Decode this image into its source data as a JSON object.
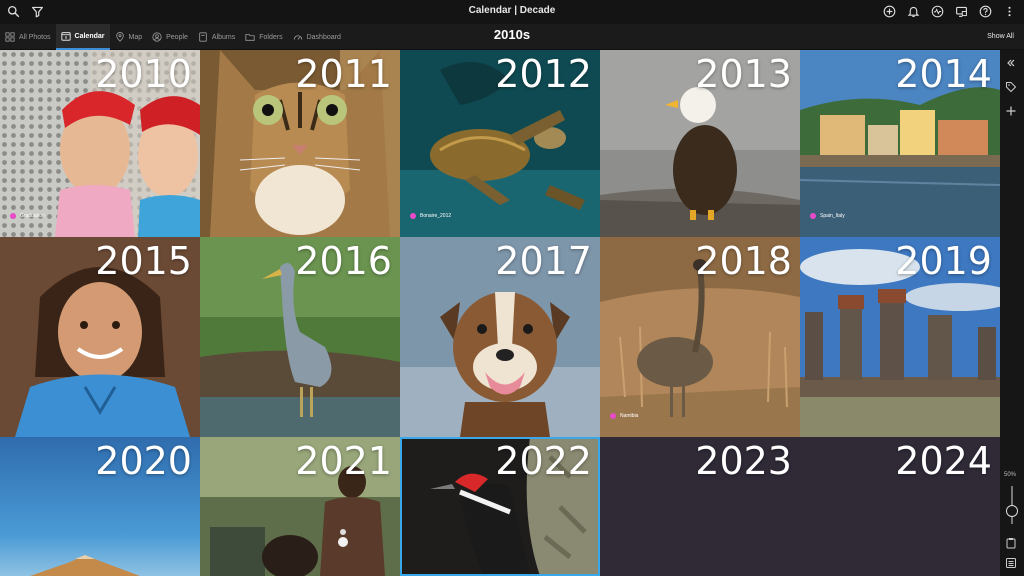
{
  "window": {
    "title": "Calendar | Decade"
  },
  "toolbar": {
    "left_icons": [
      "search-icon",
      "filter-icon"
    ],
    "right_icons": [
      "add-circle-icon",
      "bell-icon",
      "activity-icon",
      "display-icon",
      "help-icon",
      "more-vert-icon"
    ]
  },
  "nav": {
    "tabs": [
      {
        "label": "All Photos",
        "icon": "grid-icon",
        "active": false
      },
      {
        "label": "Calendar",
        "icon": "calendar-icon",
        "active": true
      },
      {
        "label": "Map",
        "icon": "map-pin-icon",
        "active": false
      },
      {
        "label": "People",
        "icon": "person-icon",
        "active": false
      },
      {
        "label": "Albums",
        "icon": "album-icon",
        "active": false
      },
      {
        "label": "Folders",
        "icon": "folder-icon",
        "active": false
      },
      {
        "label": "Dashboard",
        "icon": "gauge-icon",
        "active": false
      }
    ],
    "decade": "2010s",
    "show_all": "Show All"
  },
  "tiles": [
    {
      "year": "2010",
      "tag": "Graduation"
    },
    {
      "year": "2011",
      "tag": ""
    },
    {
      "year": "2012",
      "tag": "Bonaire_2012"
    },
    {
      "year": "2013",
      "tag": ""
    },
    {
      "year": "2014",
      "tag": "Spain_Italy"
    },
    {
      "year": "2015",
      "tag": ""
    },
    {
      "year": "2016",
      "tag": ""
    },
    {
      "year": "2017",
      "tag": ""
    },
    {
      "year": "2018",
      "tag": "Namibia"
    },
    {
      "year": "2019",
      "tag": ""
    },
    {
      "year": "2020",
      "tag": ""
    },
    {
      "year": "2021",
      "tag": ""
    },
    {
      "year": "2022",
      "tag": ""
    },
    {
      "year": "2023",
      "tag": ""
    },
    {
      "year": "2024",
      "tag": ""
    }
  ],
  "sidebar": {
    "icons": [
      "collapse-icon",
      "tag-icon",
      "plus-icon",
      "clipboard-icon",
      "list-icon"
    ],
    "zoom": "50%"
  },
  "colors": {
    "accent": "#3d8ed6",
    "selection": "#3aa7e8",
    "tag_dot": "#e84ac8"
  }
}
